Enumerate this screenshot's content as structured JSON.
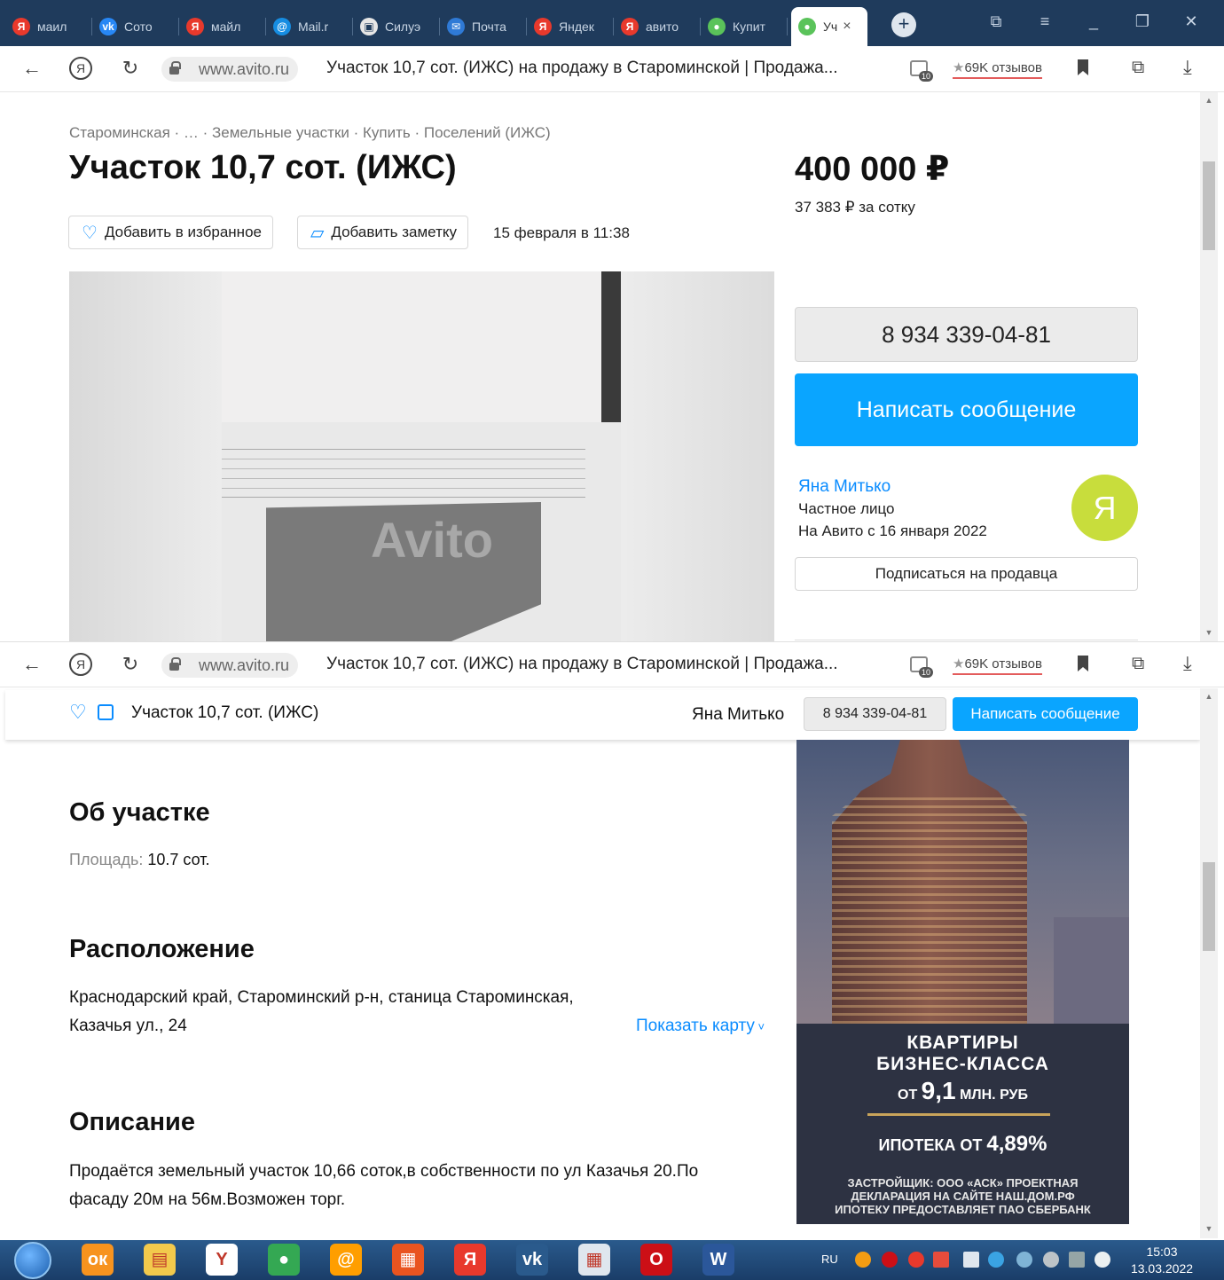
{
  "browser": {
    "tabs": [
      {
        "label": "маил",
        "icon": "yandex-icon",
        "color": "#e8392c",
        "glyph": "Я"
      },
      {
        "label": "Сото",
        "icon": "vk-icon",
        "color": "#2787f5",
        "glyph": "vk"
      },
      {
        "label": "майл",
        "icon": "yandex-icon",
        "color": "#e8392c",
        "glyph": "Я"
      },
      {
        "label": "Mail.r",
        "icon": "mailru-icon",
        "color": "#168de2",
        "glyph": "@"
      },
      {
        "label": "Силуэ",
        "icon": "picture-icon",
        "color": "#e6e6e6",
        "glyph": "▣"
      },
      {
        "label": "Почта",
        "icon": "mail-icon",
        "color": "#2f7ad6",
        "glyph": "✉"
      },
      {
        "label": "Яндек",
        "icon": "yandex-icon",
        "color": "#e8392c",
        "glyph": "Я"
      },
      {
        "label": "авито",
        "icon": "yandex-icon",
        "color": "#e8392c",
        "glyph": "Я"
      },
      {
        "label": "Купит",
        "icon": "avito-icon",
        "color": "#5ac35a",
        "glyph": "●"
      }
    ],
    "active_tab": {
      "label": "Уч",
      "close": "×"
    },
    "domain": "www.avito.ru",
    "page_title": "Участок 10,7 сот. (ИЖС) на продажу в Староминской | Продажа...",
    "tab_count": "10",
    "reviews": {
      "star": "★",
      "label": "69K отзывов"
    }
  },
  "page": {
    "breadcrumb": "Староминская · … · Земельные участки · Купить · Поселений (ИЖС)",
    "title": "Участок 10,7 сот. (ИЖС)",
    "price": "400 000 ₽",
    "price_per": "37 383 ₽ за сотку",
    "favorite_label": "Добавить в избранное",
    "note_label": "Добавить заметку",
    "date": "15 февраля в 11:38",
    "photo_watermark": "Avito",
    "phone": "8 934 339-04-81",
    "message_label": "Написать сообщение",
    "seller": {
      "name": "Яна Митько",
      "type": "Частное лицо",
      "since": "На Авито с 16 января 2022",
      "avatar_letter": "Я",
      "avatar_color": "#c8dd3c"
    },
    "subscribe_label": "Подписаться на продавца"
  },
  "sticky": {
    "title": "Участок 10,7 сот. (ИЖС)",
    "seller": "Яна Митько",
    "phone": "8 934 339-04-81",
    "message_label": "Написать сообщение"
  },
  "details": {
    "about_heading": "Об участке",
    "area_key": "Площадь:",
    "area_value": "10.7 сот.",
    "location_heading": "Расположение",
    "address_line1": "Краснодарский край, Староминский р-н, станица Староминская,",
    "address_line2": "Казачья ул., 24",
    "map_label": "Показать карту",
    "description_heading": "Описание",
    "description_line1": "Продаётся земельный участок 10,66 соток,в собственности по ул Казачья 20.По",
    "description_line2": "фасаду 20м на 56м.Возможен торг."
  },
  "ad": {
    "line1": "КВАРТИРЫ",
    "line2": "БИЗНЕС-КЛАССА",
    "price_prefix": "ОТ",
    "price_value": "9,1",
    "price_suffix": "МЛН. РУБ",
    "mortgage_prefix": "ИПОТЕКА ОТ",
    "mortgage_value": "4,89%",
    "fine1": "ЗАСТРОЙЩИК: ООО «АСК» ПРОЕКТНАЯ",
    "fine2": "ДЕКЛАРАЦИЯ НА САЙТЕ НАШ.ДОМ.РФ",
    "fine3": "ИПОТЕКУ ПРЕДОСТАВЛЯЕТ ПАО СБЕРБАНК"
  },
  "taskbar": {
    "apps": [
      {
        "name": "odnoklassniki-icon",
        "color": "#f7931e",
        "glyph": "ок"
      },
      {
        "name": "folder-icon",
        "color": "#f2c94c",
        "glyph": "▤"
      },
      {
        "name": "yandex-browser-icon",
        "color": "#ffffff",
        "glyph": "Y"
      },
      {
        "name": "chrome-icon",
        "color": "#34a853",
        "glyph": "●"
      },
      {
        "name": "mailru-agent-icon",
        "color": "#ff9e00",
        "glyph": "@"
      },
      {
        "name": "office-icon",
        "color": "#e95420",
        "glyph": "▦"
      },
      {
        "name": "yandex-icon",
        "color": "#e8392c",
        "glyph": "Я"
      },
      {
        "name": "vk-icon",
        "color": "#2a5a8c",
        "glyph": "vk"
      },
      {
        "name": "calculator-icon",
        "color": "#dfe6ee",
        "glyph": "▦"
      },
      {
        "name": "opera-icon",
        "color": "#cc0f16",
        "glyph": "O"
      },
      {
        "name": "word-icon",
        "color": "#2b579a",
        "glyph": "W"
      }
    ],
    "lang": "RU",
    "time": "15:03",
    "date": "13.03.2022"
  }
}
